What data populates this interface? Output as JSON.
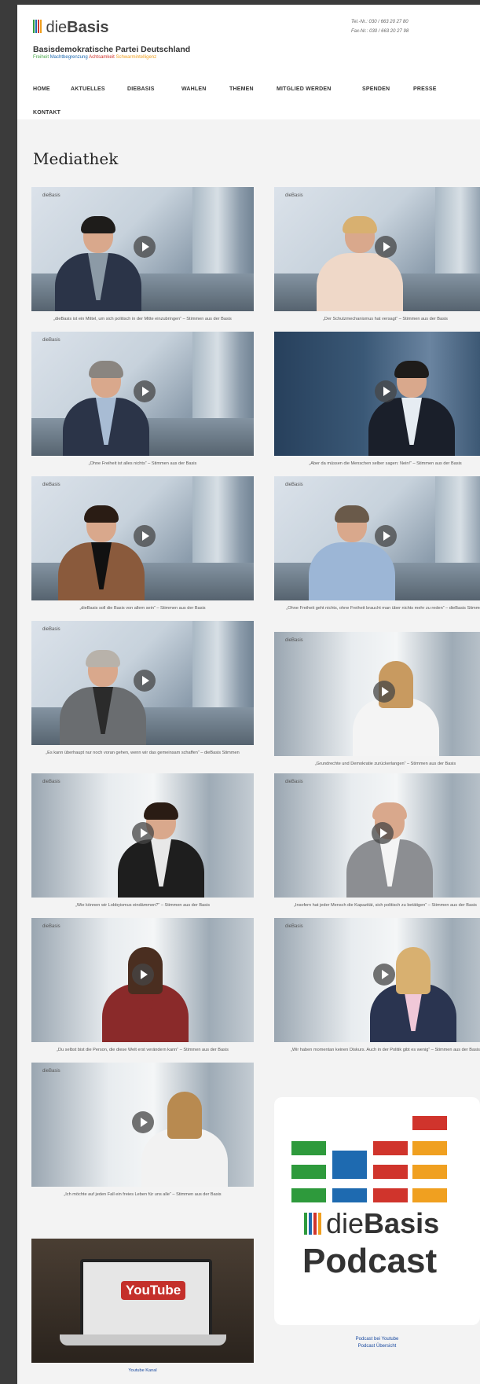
{
  "header": {
    "logo_text_plain": "die",
    "logo_text_bold": "Basis",
    "party_name": "Basisdemokratische Partei Deutschland",
    "slogan": [
      "Freiheit",
      "Machtbegrenzung",
      "Achtsamkeit",
      "Schwarmintelligenz"
    ],
    "slogan_colors": [
      "#4aa84a",
      "#1e6ab0",
      "#d0342c",
      "#f0a020"
    ],
    "phone": "Tel.-Nr.: 030 / 663 20 27 80",
    "fax": "Fax-Nr.: 030 / 663 20 27 98"
  },
  "nav": {
    "items": [
      "HOME",
      "AKTUELLES",
      "DIEBASIS",
      "WAHLEN",
      "THEMEN",
      "MITGLIED WERDEN",
      "SPENDEN",
      "PRESSE",
      "KONTAKT"
    ]
  },
  "main": {
    "title": "Mediathek",
    "video_badge": "dieBasis",
    "videos": [
      {
        "caption": "„dieBasis ist ein Mittel, um sich politisch in der Mitte einzubringen“ – Stimmen aus der Basis"
      },
      {
        "caption": "„Der Schutzmechanismus hat versagt“ – Stimmen aus der Basis"
      },
      {
        "caption": "„Ohne Freiheit ist alles nichts“ – Stimmen aus der Basis"
      },
      {
        "caption": "„Aber da müssen die Menschen selber sagen: Nein!“ – Stimmen aus der Basis"
      },
      {
        "caption": "„dieBasis soll die Basis von allem sein“ – Stimmen aus der Basis"
      },
      {
        "caption": "„Ohne Freiheit geht nichts, ohne Freiheit braucht man über nichts mehr zu reden“ – dieBasis Stimmen"
      },
      {
        "caption": "„Es kann überhaupt nur noch voran gehen, wenn wir das gemeinsam schaffen“ – dieBasis Stimmen"
      },
      {
        "caption": "„Grundrechte und Demokratie zurückerlangen“ – Stimmen aus der Basis"
      },
      {
        "caption": "„Wie können wir Lobbyismus eindämmen?“ – Stimmen aus der Basis"
      },
      {
        "caption": "„Insofern hat jeder Mensch die Kapazität, sich politisch zu betätigen“ – Stimmen aus der Basis"
      },
      {
        "caption": "„Du selbst bist die Person, die diese Welt erst verändern kann“ – Stimmen aus der Basis"
      },
      {
        "caption": "„Wir haben momentan keinen Diskurs. Auch in der Politik gibt es wenig“ – Stimmen aus der Basis"
      },
      {
        "caption": "„Ich möchte auf jeden Fall ein freies Leben für uns alle“ – Stimmen aus der Basis"
      }
    ],
    "youtube": {
      "logo_you": "You",
      "logo_tube": "Tube",
      "caption": "Youtube Kanal"
    },
    "podcast": {
      "logo_plain": "die",
      "logo_bold": "Basis",
      "title": "Podcast",
      "links": [
        "Podcast bei Youtube",
        "Podcast Übersicht"
      ],
      "bar_colors": {
        "green": "#2e9a3c",
        "blue": "#1e6ab0",
        "red": "#d0342c",
        "orange": "#f0a020"
      }
    }
  }
}
